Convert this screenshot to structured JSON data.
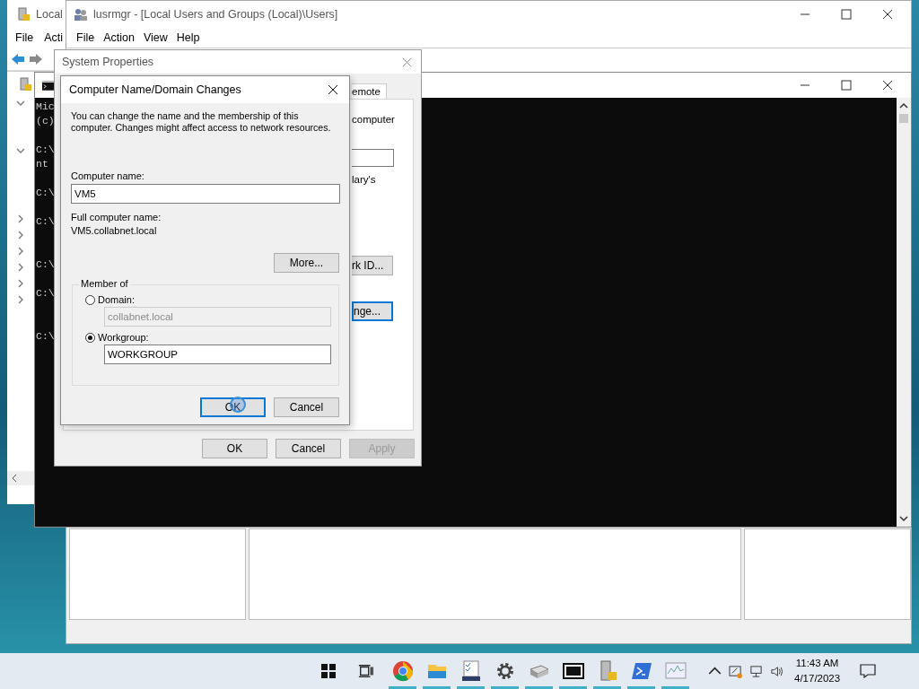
{
  "back_window": {
    "title": "Local",
    "menu": [
      "File",
      "Acti"
    ],
    "tree": [
      {
        "expanded": true
      },
      {
        "expanded": true
      },
      {
        "expanded": false
      },
      {
        "expanded": false
      },
      {
        "expanded": false
      },
      {
        "expanded": false
      },
      {
        "expanded": false
      },
      {
        "expanded": false
      }
    ]
  },
  "main_window": {
    "title": "lusrmgr - [Local Users and Groups (Local)\\Users]",
    "menu": [
      "File",
      "Action",
      "View",
      "Help"
    ]
  },
  "console": {
    "lines": [
      "Mic",
      "(c)",
      "C:\\",
      "nt",
      "C:\\",
      "C:\\",
      "C:\\",
      "C:\\",
      "C:\\"
    ]
  },
  "system_properties": {
    "title": "System Properties",
    "tabs": [
      {
        "label": "emote",
        "selected": false
      }
    ],
    "fragments": [
      "computer",
      "lary's"
    ],
    "network_id_button": "rk ID...",
    "change_button": {
      "label": "nge...",
      "focused": true
    },
    "buttons": [
      {
        "label": "OK",
        "disabled": false
      },
      {
        "label": "Cancel",
        "disabled": false
      },
      {
        "label": "Apply",
        "disabled": true
      }
    ]
  },
  "dialog": {
    "title": "Computer Name/Domain Changes",
    "description": "You can change the name and the membership of this computer. Changes might affect access to network resources.",
    "computer_name_label": "Computer name:",
    "computer_name": "VM5",
    "full_name_label": "Full computer name:",
    "full_name": "VM5.collabnet.local",
    "more_button": "More...",
    "member_of": "Member of",
    "options": [
      {
        "label": "Domain:",
        "selected": false,
        "value": "collabnet.local"
      },
      {
        "label": "Workgroup:",
        "selected": true,
        "value": "WORKGROUP"
      }
    ],
    "buttons": [
      {
        "label": "OK",
        "focused": true
      },
      {
        "label": "Cancel",
        "focused": false
      }
    ]
  },
  "taskbar": {
    "apps": [
      {
        "kind": "chrome",
        "running": true
      },
      {
        "kind": "folder",
        "running": true
      },
      {
        "kind": "checklist",
        "running": true
      },
      {
        "kind": "gear",
        "running": true
      },
      {
        "kind": "drive",
        "running": true
      },
      {
        "kind": "archive",
        "running": true
      },
      {
        "kind": "server",
        "running": true
      },
      {
        "kind": "shell",
        "running": true
      },
      {
        "kind": "monitor",
        "running": true
      }
    ],
    "time": "11:43 AM",
    "date": "4/17/2023"
  }
}
